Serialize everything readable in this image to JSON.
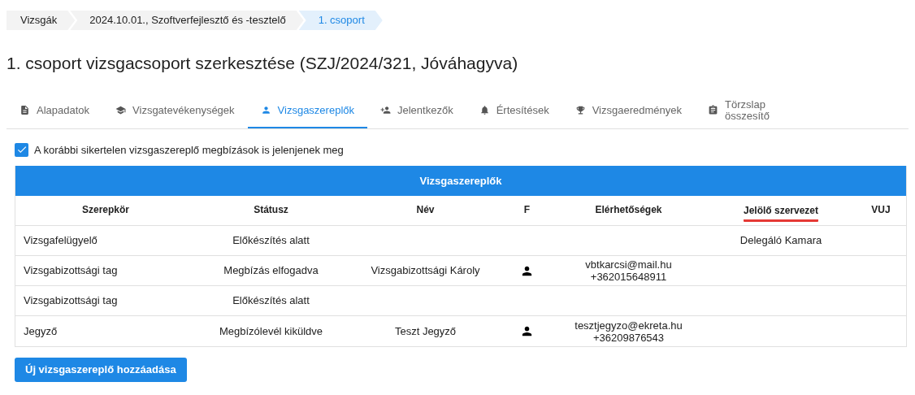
{
  "breadcrumbs": [
    {
      "label": "Vizsgák",
      "selected": false
    },
    {
      "label": "2024.10.01., Szoftverfejlesztő és -tesztelő",
      "selected": false
    },
    {
      "label": "1. csoport",
      "selected": true
    }
  ],
  "title": "1. csoport vizsgacsoport szerkesztése (SZJ/2024/321, Jóváhagyva)",
  "tabs": [
    {
      "label": "Alapadatok",
      "selected": false
    },
    {
      "label": "Vizsgatevékenységek",
      "selected": false
    },
    {
      "label": "Vizsgaszereplők",
      "selected": true
    },
    {
      "label": "Jelentkezők",
      "selected": false
    },
    {
      "label": "Értesítések",
      "selected": false
    },
    {
      "label": "Vizsgaeredmények",
      "selected": false
    },
    {
      "label": "Törzslap összesítő",
      "selected": false
    }
  ],
  "checkbox": {
    "label": "A korábbi sikertelen vizsgaszereplő megbízások is jelenjenek meg",
    "checked": true
  },
  "table": {
    "title": "Vizsgaszereplők",
    "columns": [
      {
        "label": "Szerepkör",
        "underlined": false
      },
      {
        "label": "Státusz",
        "underlined": false
      },
      {
        "label": "Név",
        "underlined": false
      },
      {
        "label": "F",
        "underlined": false
      },
      {
        "label": "Elérhetőségek",
        "underlined": false
      },
      {
        "label": "Jelölő szervezet",
        "underlined": true
      },
      {
        "label": "VUJ",
        "underlined": false
      }
    ],
    "rows": [
      {
        "role": "Vizsgafelügyelő",
        "status": "Előkészítés alatt",
        "person_icon": false,
        "organization": "Delegáló Kamara"
      },
      {
        "role": "Vizsgabizottsági tag",
        "status": "Megbízás elfogadva",
        "name": "Vizsgabizottsági Károly",
        "person_icon": true,
        "contacts": [
          "vbtkarcsi@mail.hu",
          "+362015648911"
        ]
      },
      {
        "role": "Vizsgabizottsági tag",
        "status": "Előkészítés alatt",
        "person_icon": false
      },
      {
        "role": "Jegyző",
        "status": "Megbízólevél kiküldve",
        "name": "Teszt Jegyző",
        "person_icon": true,
        "contacts": [
          "tesztjegyzo@ekreta.hu",
          "+36209876543"
        ]
      }
    ]
  },
  "add_button": "Új vizsgaszereplő hozzáadása"
}
